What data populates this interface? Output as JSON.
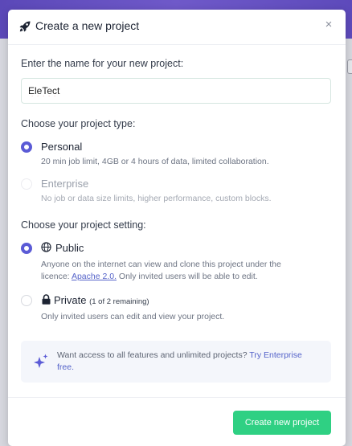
{
  "modal": {
    "title": "Create a new project",
    "close_glyph": "×",
    "name_label": "Enter the name for your new project:",
    "name_value": "EleTect",
    "type_label": "Choose your project type:",
    "types": [
      {
        "label": "Personal",
        "desc": "20 min job limit, 4GB or 4 hours of data, limited collaboration.",
        "selected": true
      },
      {
        "label": "Enterprise",
        "desc": "No job or data size limits, higher performance, custom blocks.",
        "selected": false
      }
    ],
    "setting_label": "Choose your project setting:",
    "public": {
      "label": "Public",
      "desc_line1": "Anyone on the internet can view and clone this project under the",
      "desc_prefix": "licence: ",
      "link": "Apache 2.0.",
      "desc_suffix": " Only invited users will be able to edit.",
      "selected": true
    },
    "private": {
      "label": "Private",
      "note": "(1 of 2 remaining)",
      "desc": "Only invited users can edit and view your project.",
      "selected": false
    },
    "promo": {
      "text": "Want access to all features and unlimited projects? ",
      "link": "Try Enterprise free."
    },
    "create_button": "Create new project"
  },
  "colors": {
    "accent": "#5b5bd6",
    "button": "#2fd083",
    "link": "#5563c9",
    "header_band": "#6f59c9"
  },
  "icons": [
    "rocket-icon",
    "close-icon",
    "globe-icon",
    "lock-icon",
    "sparkle-icon"
  ]
}
